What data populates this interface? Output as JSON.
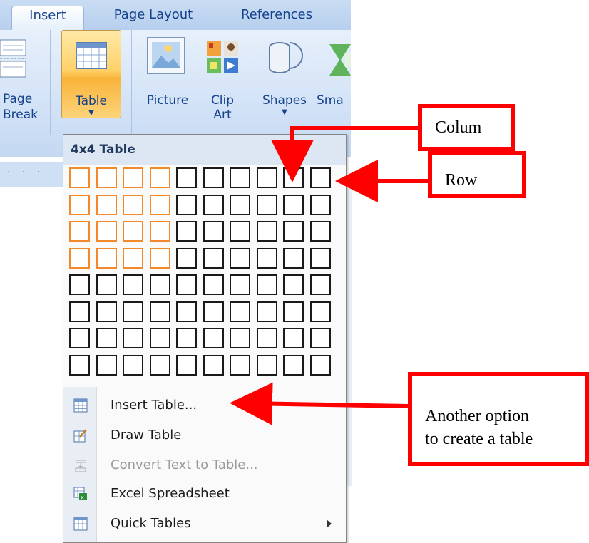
{
  "ribbon": {
    "tabs": [
      "Insert",
      "Page Layout",
      "References"
    ],
    "buttons": {
      "page_break_line1": "Page",
      "page_break_line2": "Break",
      "table": "Table",
      "picture": "Picture",
      "clip_art_line1": "Clip",
      "clip_art_line2": "Art",
      "shapes": "Shapes",
      "smartart": "Sma"
    }
  },
  "menu": {
    "header": "4x4 Table",
    "grid": {
      "columns": 10,
      "rows": 8,
      "selected_columns": 4,
      "selected_rows": 4
    },
    "items": [
      {
        "label": "Insert Table...",
        "icon": "insert-table-icon",
        "enabled": true
      },
      {
        "label": "Draw Table",
        "icon": "draw-table-icon",
        "enabled": true
      },
      {
        "label": "Convert Text to Table...",
        "icon": "convert-text-icon",
        "enabled": false
      },
      {
        "label": "Excel Spreadsheet",
        "icon": "excel-spreadsheet-icon",
        "enabled": true
      },
      {
        "label": "Quick Tables",
        "icon": "quick-tables-icon",
        "enabled": true,
        "submenu": true
      }
    ]
  },
  "annotations": {
    "colum": "Colum",
    "row": "Row",
    "another_line1": "Another option",
    "another_line2": "to create a table",
    "color": "#ff0000"
  }
}
